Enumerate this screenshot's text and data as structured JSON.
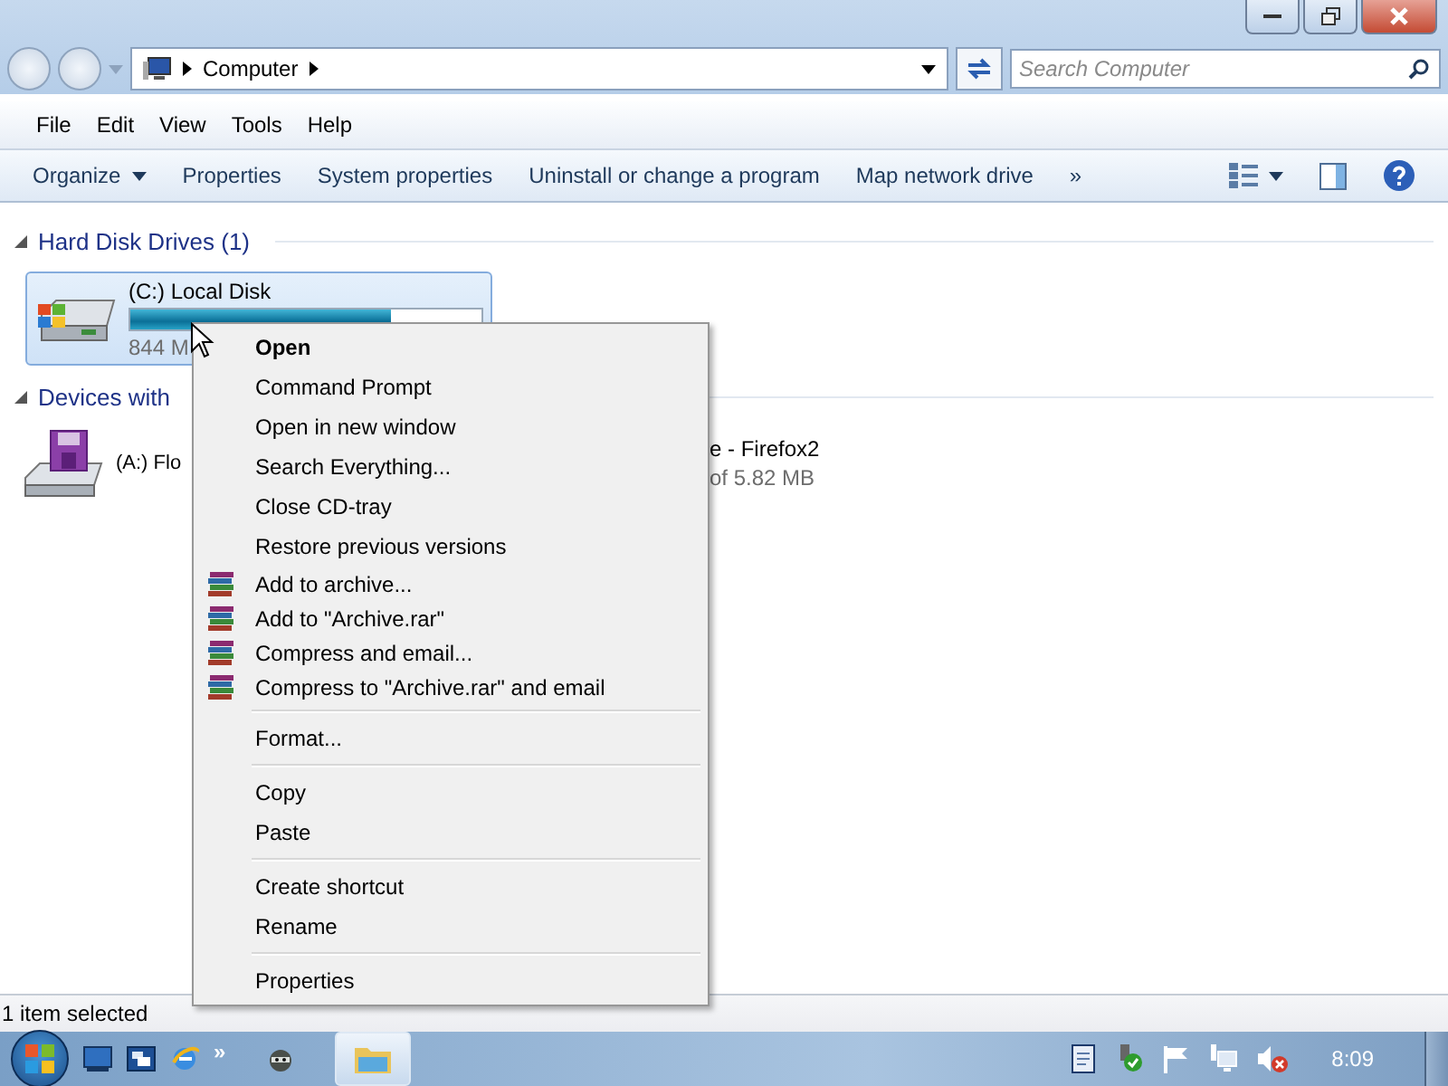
{
  "address": {
    "crumb": "Computer"
  },
  "search": {
    "placeholder": "Search Computer"
  },
  "menubar": [
    "File",
    "Edit",
    "View",
    "Tools",
    "Help"
  ],
  "commands": [
    {
      "label": "Organize",
      "dropdown": true
    },
    {
      "label": "Properties",
      "dropdown": false
    },
    {
      "label": "System properties",
      "dropdown": false
    },
    {
      "label": "Uninstall or change a program",
      "dropdown": false
    },
    {
      "label": "Map network drive",
      "dropdown": false
    }
  ],
  "more": "»",
  "groups": [
    {
      "title": "Hard Disk Drives (1)",
      "expanded": true
    },
    {
      "title": "Devices with",
      "expanded": true
    }
  ],
  "drive": {
    "name": "(C:) Local Disk",
    "level": 0.74,
    "info": "844 M",
    "selected": true
  },
  "floppy": {
    "name": "(A:) Flo"
  },
  "hidden_item": {
    "name": "e - Firefox2",
    "info": "of 5.82 MB"
  },
  "context_menu": [
    {
      "kind": "item",
      "label": "Open",
      "default": true
    },
    {
      "kind": "item",
      "label": "Command Prompt",
      "default": false
    },
    {
      "kind": "item",
      "label": "Open in new window",
      "default": false
    },
    {
      "kind": "item",
      "label": "Search Everything...",
      "default": false
    },
    {
      "kind": "item",
      "label": "Close CD-tray",
      "default": false
    },
    {
      "kind": "item",
      "label": "Restore previous versions",
      "default": false
    },
    {
      "kind": "archive",
      "label": "Add to archive...",
      "default": false
    },
    {
      "kind": "archive",
      "label": "Add to \"Archive.rar\"",
      "default": false
    },
    {
      "kind": "archive",
      "label": "Compress and email...",
      "default": false
    },
    {
      "kind": "archive",
      "label": "Compress to \"Archive.rar\" and email",
      "default": false
    },
    {
      "kind": "separator"
    },
    {
      "kind": "item",
      "label": "Format...",
      "default": false
    },
    {
      "kind": "separator"
    },
    {
      "kind": "item",
      "label": "Copy",
      "default": false
    },
    {
      "kind": "item",
      "label": "Paste",
      "default": false
    },
    {
      "kind": "separator"
    },
    {
      "kind": "item",
      "label": "Create shortcut",
      "default": false
    },
    {
      "kind": "item",
      "label": "Rename",
      "default": false
    },
    {
      "kind": "separator"
    },
    {
      "kind": "item",
      "label": "Properties",
      "default": false
    }
  ],
  "status_bar": "1 item selected",
  "taskbar": {
    "more": "»",
    "clock": "8:09"
  }
}
